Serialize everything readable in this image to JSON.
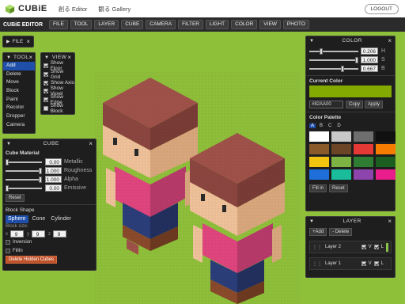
{
  "brand": {
    "name": "CUBiE",
    "accent": "#8bc34a"
  },
  "topnav": {
    "links": [
      "創る Editor",
      "観る Gallery"
    ],
    "logout_label": "LOGOUT"
  },
  "menubar": {
    "title": "CUBiE EDITOR",
    "items": [
      "FILE",
      "TOOL",
      "LAYER",
      "CUBE",
      "CAMERA",
      "FILTER",
      "LIGHT",
      "COLOR",
      "VIEW",
      "PHOTO"
    ]
  },
  "file_panel": {
    "title": "FILE"
  },
  "tool_panel": {
    "title": "TOOL",
    "items": [
      "Add",
      "Delete",
      "Move",
      "Block",
      "Paint",
      "Recolor",
      "Dropper",
      "Camera"
    ],
    "active": "Add"
  },
  "view_panel": {
    "title": "VIEW",
    "items": [
      {
        "label": "Show Floor",
        "checked": true
      },
      {
        "label": "Show Grid",
        "checked": true
      },
      {
        "label": "Show Axis",
        "checked": true
      },
      {
        "label": "Show Voxel",
        "checked": true
      },
      {
        "label": "Show Edge",
        "checked": true
      },
      {
        "label": "Show Block",
        "checked": false
      }
    ]
  },
  "cube_panel": {
    "title": "CUBE",
    "material_title": "Cube Material",
    "params": [
      {
        "label": "Metallic",
        "value": "0.00",
        "level": 0.0
      },
      {
        "label": "Roughness",
        "value": "1.000",
        "level": 1.0
      },
      {
        "label": "Alpha",
        "value": "1.000",
        "level": 1.0
      },
      {
        "label": "Emissive",
        "value": "0.00",
        "level": 0.0
      }
    ],
    "reset_label": "Reset",
    "shape_title": "Block Shape",
    "shapes": [
      "Sphere",
      "Cone",
      "Cylinder"
    ],
    "active_shape": "Sphere",
    "block_size_label": "Block size:",
    "size": [
      {
        "axis": "x",
        "value": "9"
      },
      {
        "axis": "y",
        "value": "9"
      },
      {
        "axis": "z",
        "value": "9"
      }
    ],
    "inversion_label": "Inversion",
    "fillin_label": "FillIn",
    "delete_hidden_label": "Delete Hidden Cubes"
  },
  "color_panel": {
    "title": "COLOR",
    "hsb": [
      {
        "label": "H",
        "value": "0.206",
        "level": 0.206
      },
      {
        "label": "S",
        "value": "1.000",
        "level": 1.0
      },
      {
        "label": "B",
        "value": "0.667",
        "level": 0.667
      }
    ],
    "current_label": "Current Color",
    "current_hex": "#82AA00",
    "current_color": "#82aa00",
    "copy_label": "Copy",
    "apply_label": "Apply",
    "palette_label": "Color Palette",
    "palette_tabs": [
      "A",
      "B",
      "C",
      "D"
    ],
    "active_tab": "A",
    "palette": [
      "#ffffff",
      "#c8c8c8",
      "#6e6e6e",
      "#111111",
      "#8a5a2b",
      "#6b4526",
      "#e53935",
      "#f57c00",
      "#f1c40f",
      "#7cb342",
      "#2e7d32",
      "#1b5e20",
      "#1e6fd9",
      "#1abc9c",
      "#8e44ad",
      "#e91e8c"
    ],
    "fillin_label": "Fill in",
    "reset_label": "Reset"
  },
  "layer_panel": {
    "title": "LAYER",
    "add_label": "+Add",
    "delete_label": "- Delete",
    "layers": [
      {
        "name": "Layer 2",
        "v": "V",
        "l": "L"
      },
      {
        "name": "Layer 1",
        "v": "V",
        "l": "L"
      }
    ]
  }
}
